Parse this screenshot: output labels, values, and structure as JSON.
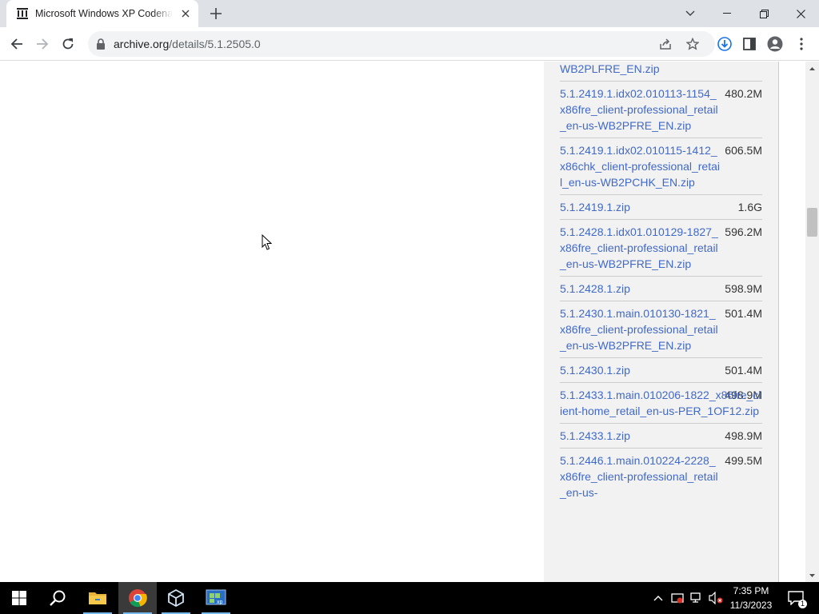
{
  "browser": {
    "tab_title": "Microsoft Windows XP Codename Whistler",
    "url_host": "archive.org",
    "url_path": "/details/5.1.2505.0"
  },
  "files": [
    {
      "name": "WB2PLFRE_EN.zip",
      "size": ""
    },
    {
      "name": "5.1.2419.1.idx02.010113-1154_x86fre_client-professional_retail_en-us-WB2PFRE_EN.zip",
      "size": "480.2M"
    },
    {
      "name": "5.1.2419.1.idx02.010115-1412_x86chk_client-professional_retail_en-us-WB2PCHK_EN.zip",
      "size": "606.5M"
    },
    {
      "name": "5.1.2419.1.zip",
      "size": "1.6G"
    },
    {
      "name": "5.1.2428.1.idx01.010129-1827_x86fre_client-professional_retail_en-us-WB2PFRE_EN.zip",
      "size": "596.2M"
    },
    {
      "name": "5.1.2428.1.zip",
      "size": "598.9M"
    },
    {
      "name": "5.1.2430.1.main.010130-1821_x86fre_client-professional_retail_en-us-WB2PFRE_EN.zip",
      "size": "501.4M"
    },
    {
      "name": "5.1.2430.1.zip",
      "size": "501.4M"
    },
    {
      "name": "5.1.2433.1.main.010206-1822_x86fre_client-home_retail_en-us-PER_1OF12.zip",
      "size": "498.9M"
    },
    {
      "name": "5.1.2433.1.zip",
      "size": "498.9M"
    },
    {
      "name": "5.1.2446.1.main.010224-2228_x86fre_client-professional_retail_en-us-",
      "size": "499.5M"
    }
  ],
  "taskbar": {
    "time": "7:35 PM",
    "date": "11/3/2023",
    "notification_count": "1"
  },
  "colors": {
    "link": "#4169c8",
    "panel_bg": "#f2f2f2",
    "tab_strip": "#dee1e6"
  }
}
